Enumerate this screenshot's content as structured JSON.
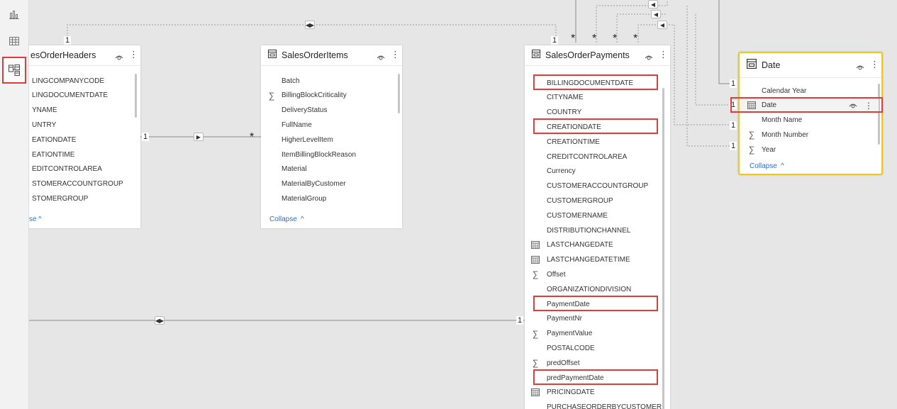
{
  "left_rail": {
    "items": [
      {
        "name": "report-view",
        "icon": "bar-chart-icon",
        "active": false
      },
      {
        "name": "data-view",
        "icon": "table-icon",
        "active": false
      },
      {
        "name": "model-view",
        "icon": "model-icon",
        "active": true
      }
    ]
  },
  "tables": {
    "headers": {
      "title": "esOrderHeaders",
      "fields": [
        "LINGCOMPANYCODE",
        "LINGDOCUMENTDATE",
        "YNAME",
        "UNTRY",
        "EATIONDATE",
        "EATIONTIME",
        "EDITCONTROLAREA",
        "STOMERACCOUNTGROUP",
        "STOMERGROUP"
      ],
      "collapse": "se"
    },
    "items": {
      "title": "SalesOrderItems",
      "fields": [
        {
          "name": "Batch",
          "icon": ""
        },
        {
          "name": "BillingBlockCriticality",
          "icon": "sigma"
        },
        {
          "name": "DeliveryStatus",
          "icon": ""
        },
        {
          "name": "FullName",
          "icon": ""
        },
        {
          "name": "HigherLevelItem",
          "icon": ""
        },
        {
          "name": "ItemBillingBlockReason",
          "icon": ""
        },
        {
          "name": "Material",
          "icon": ""
        },
        {
          "name": "MaterialByCustomer",
          "icon": ""
        },
        {
          "name": "MaterialGroup",
          "icon": ""
        }
      ],
      "collapse": "Collapse"
    },
    "payments": {
      "title": "SalesOrderPayments",
      "fields": [
        {
          "name": "BILLINGDOCUMENTDATE",
          "icon": "",
          "highlight": true
        },
        {
          "name": "CITYNAME",
          "icon": ""
        },
        {
          "name": "COUNTRY",
          "icon": ""
        },
        {
          "name": "CREATIONDATE",
          "icon": "",
          "highlight": true
        },
        {
          "name": "CREATIONTIME",
          "icon": ""
        },
        {
          "name": "CREDITCONTROLAREA",
          "icon": ""
        },
        {
          "name": "Currency",
          "icon": ""
        },
        {
          "name": "CUSTOMERACCOUNTGROUP",
          "icon": ""
        },
        {
          "name": "CUSTOMERGROUP",
          "icon": ""
        },
        {
          "name": "CUSTOMERNAME",
          "icon": ""
        },
        {
          "name": "DISTRIBUTIONCHANNEL",
          "icon": ""
        },
        {
          "name": "LASTCHANGEDATE",
          "icon": "calendar"
        },
        {
          "name": "LASTCHANGEDATETIME",
          "icon": "calendar"
        },
        {
          "name": "Offset",
          "icon": "sigma"
        },
        {
          "name": "ORGANIZATIONDIVISION",
          "icon": ""
        },
        {
          "name": "PaymentDate",
          "icon": "",
          "highlight": true
        },
        {
          "name": "PaymentNr",
          "icon": ""
        },
        {
          "name": "PaymentValue",
          "icon": "sigma"
        },
        {
          "name": "POSTALCODE",
          "icon": ""
        },
        {
          "name": "predOffset",
          "icon": "sigma"
        },
        {
          "name": "predPaymentDate",
          "icon": "",
          "highlight": true
        },
        {
          "name": "PRICINGDATE",
          "icon": "calendar"
        },
        {
          "name": "PURCHASEORDERBYCUSTOMER",
          "icon": ""
        }
      ]
    },
    "date": {
      "title": "Date",
      "fields": [
        {
          "name": "Calendar Year",
          "icon": ""
        },
        {
          "name": "Date",
          "icon": "calendar",
          "highlight": true
        },
        {
          "name": "Month Name",
          "icon": ""
        },
        {
          "name": "Month Number",
          "icon": "sigma"
        },
        {
          "name": "Year",
          "icon": "sigma"
        }
      ],
      "collapse": "Collapse",
      "border_color": "#f2c811"
    }
  },
  "relationships": {
    "one": "1",
    "many": "*"
  },
  "colors": {
    "canvas": "#e6e6e6",
    "highlight": "#e03c3c",
    "link": "#2b6fbd"
  }
}
